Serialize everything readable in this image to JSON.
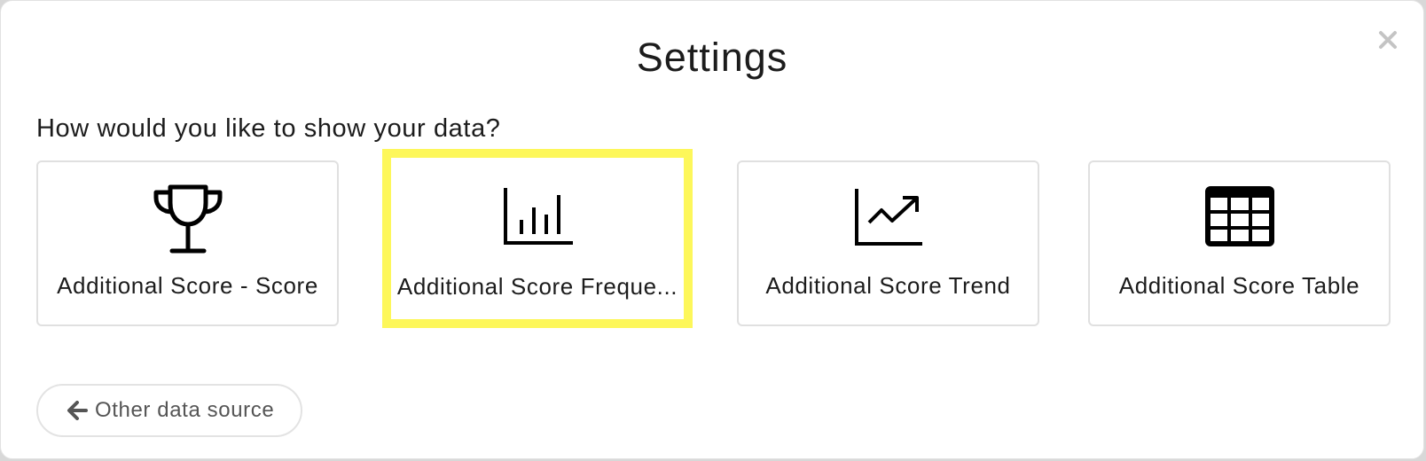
{
  "dialog": {
    "title": "Settings",
    "close_icon": "close-icon"
  },
  "question": "How would you like to show your data?",
  "options": [
    {
      "label": "Additional Score - Score",
      "icon": "trophy-icon",
      "selected": false
    },
    {
      "label": "Additional Score Freque...",
      "icon": "bar-chart-icon",
      "selected": true
    },
    {
      "label": "Additional Score Trend",
      "icon": "trend-chart-icon",
      "selected": false
    },
    {
      "label": "Additional Score Table",
      "icon": "table-icon",
      "selected": false
    }
  ],
  "back_button": {
    "label": "Other data source",
    "icon": "arrow-left-icon"
  },
  "colors": {
    "highlight": "#fdf75a",
    "text": "#1c1c1c",
    "border": "#e0e0e0",
    "muted": "#555555"
  }
}
